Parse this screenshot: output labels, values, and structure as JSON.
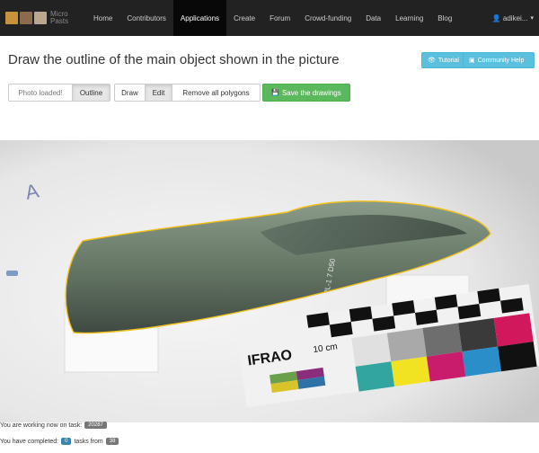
{
  "navbar": {
    "logo_text": "Micro\nPasts",
    "items": [
      {
        "label": "Home"
      },
      {
        "label": "Contributors"
      },
      {
        "label": "Applications",
        "active": true
      },
      {
        "label": "Create"
      },
      {
        "label": "Forum"
      },
      {
        "label": "Crowd-funding"
      },
      {
        "label": "Data"
      },
      {
        "label": "Learning"
      },
      {
        "label": "Blog"
      }
    ],
    "user": "adikei..."
  },
  "page": {
    "title": "Draw the outline of the main object shown in the picture",
    "tutorial_label": "Tutorial",
    "community_help_label": "Community Help"
  },
  "toolbar": {
    "photo_loaded": "Photo loaded!",
    "outline": "Outline",
    "draw": "Draw",
    "edit": "Edit",
    "remove_all": "Remove all polygons",
    "save": "Save the drawings"
  },
  "photo": {
    "scale_brand": "IFRAO",
    "scale_text": "10 cm",
    "object_marking": "PL-1 7 D50",
    "letter": "A",
    "outline_color": "#f2c21b"
  },
  "status": {
    "working_prefix": "You are working now on task:",
    "task_id": "20287",
    "completed_prefix": "You have completed:",
    "completed_count": "0",
    "tasks_from": "tasks from",
    "total": "38"
  }
}
